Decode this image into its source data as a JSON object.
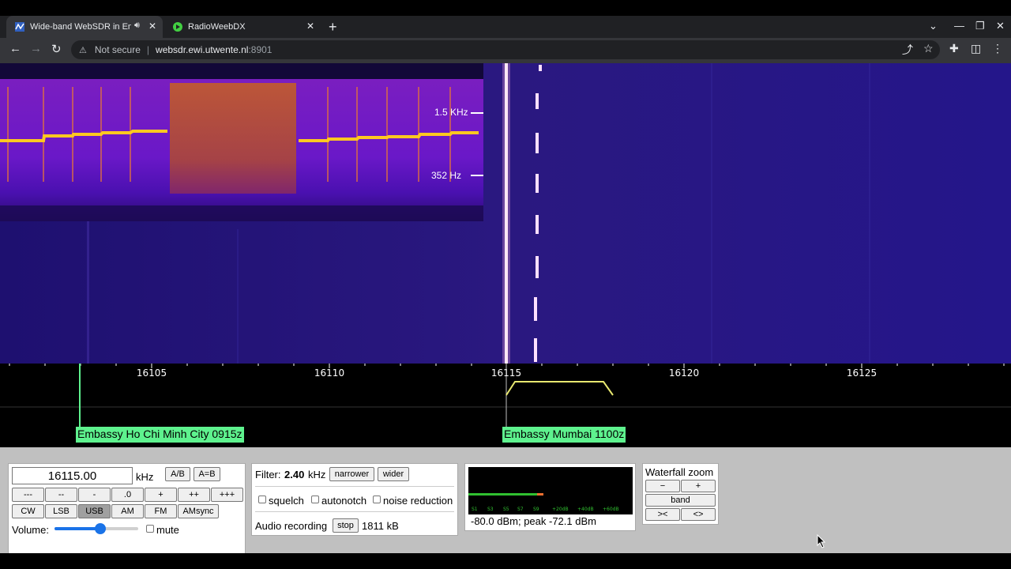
{
  "browser": {
    "tabs": [
      {
        "title": "Wide-band WebSDR in Ensch",
        "active": true,
        "icon": "websdr-favicon",
        "audio_icon": "speaker-icon"
      },
      {
        "title": "RadioWeebDX",
        "active": false,
        "icon": "play-favicon"
      }
    ],
    "address": {
      "security_text": "Not secure",
      "host": "websdr.ewi.utwente.nl",
      "port": ":8901"
    }
  },
  "waterfall": {
    "overlay_labels": [
      "1.5 KHz",
      "352 Hz"
    ]
  },
  "scale": {
    "ticks": [
      "16105",
      "16110",
      "16115",
      "16120",
      "16125"
    ],
    "stations": [
      {
        "label": "Embassy Ho Chi Minh City 0915z"
      },
      {
        "label": "Embassy Mumbai 1100z"
      }
    ]
  },
  "tuning": {
    "frequency": "16115.00",
    "unit": "kHz",
    "ab_label": "A/B",
    "a_eq_b_label": "A=B",
    "step_buttons": [
      "---",
      "--",
      "-",
      ".0",
      "+",
      "++",
      "+++"
    ],
    "modes": [
      "CW",
      "LSB",
      "USB",
      "AM",
      "FM",
      "AMsync"
    ],
    "active_mode": "USB",
    "volume_label": "Volume:",
    "volume_level": 0.55,
    "mute_label": "mute"
  },
  "filter": {
    "label": "Filter:",
    "value": "2.40",
    "unit": "kHz",
    "narrower_label": "narrower",
    "wider_label": "wider",
    "squelch_label": "squelch",
    "autonotch_label": "autonotch",
    "noise_reduction_label": "noise reduction",
    "recording_label": "Audio recording",
    "stop_label": "stop",
    "recording_size": "1811 kB"
  },
  "smeter": {
    "scale_labels": [
      "S1",
      "S3",
      "S5",
      "S7",
      "S9",
      "+20dB",
      "+40dB",
      "+60dB"
    ],
    "reading": "-80.0 dBm; peak  -72.1 dBm",
    "level_fraction": 0.42
  },
  "zoom": {
    "title": "Waterfall zoom",
    "minus_label": "−",
    "plus_label": "+",
    "band_label": "band",
    "narrow_label": "><",
    "wide_label": "<>"
  },
  "colors": {
    "station_label": "#5ef28e",
    "passband": "#e8e870",
    "waterfall_bg": "#2a1878"
  }
}
